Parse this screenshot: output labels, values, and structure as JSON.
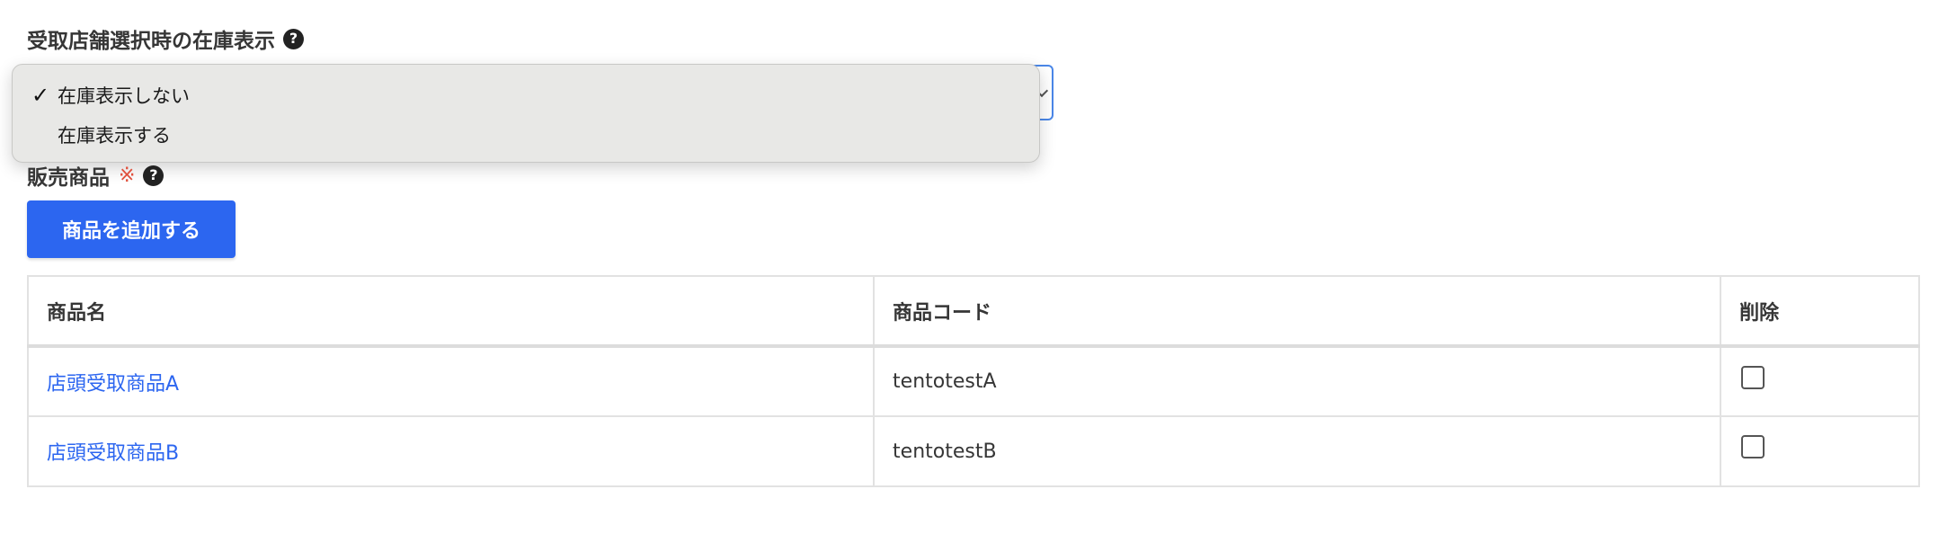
{
  "stock_display": {
    "label": "受取店舗選択時の在庫表示",
    "help_icon": "question-circle-icon",
    "options": [
      {
        "label": "在庫表示しない",
        "selected": true
      },
      {
        "label": "在庫表示する",
        "selected": false
      }
    ],
    "check_glyph": "✓"
  },
  "products": {
    "label": "販売商品",
    "required_mark": "※",
    "help_icon": "question-circle-icon",
    "add_button_label": "商品を追加する",
    "columns": [
      "商品名",
      "商品コード",
      "削除"
    ],
    "rows": [
      {
        "name": "店頭受取商品A",
        "code": "tentotestA",
        "delete": false
      },
      {
        "name": "店頭受取商品B",
        "code": "tentotestB",
        "delete": false
      }
    ]
  },
  "colors": {
    "primary": "#2c66f0",
    "link": "#2c66f0",
    "required": "#e0503c",
    "focus_border": "#4a87e8"
  }
}
